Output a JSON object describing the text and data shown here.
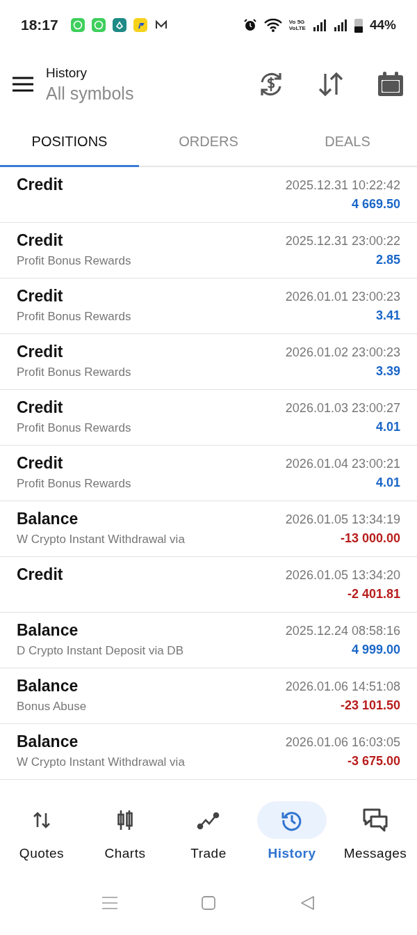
{
  "status_bar": {
    "time": "18:17",
    "network_top": "Vo 5G",
    "network_bottom": "VoLTE",
    "battery": "44%"
  },
  "header": {
    "title": "History",
    "subtitle": "All symbols"
  },
  "tabs": [
    {
      "label": "POSITIONS",
      "selected": true
    },
    {
      "label": "ORDERS",
      "selected": false
    },
    {
      "label": "DEALS",
      "selected": false
    }
  ],
  "rows": [
    {
      "type": "Credit",
      "time": "2025.12.31 10:22:42",
      "amount": "4 669.50",
      "kind": "positive"
    },
    {
      "type": "Credit",
      "comment": "Profit Bonus Rewards",
      "time": "2025.12.31 23:00:22",
      "amount": "2.85",
      "kind": "positive"
    },
    {
      "type": "Credit",
      "comment": "Profit Bonus Rewards",
      "time": "2026.01.01 23:00:23",
      "amount": "3.41",
      "kind": "positive"
    },
    {
      "type": "Credit",
      "comment": "Profit Bonus Rewards",
      "time": "2026.01.02 23:00:23",
      "amount": "3.39",
      "kind": "positive"
    },
    {
      "type": "Credit",
      "comment": "Profit Bonus Rewards",
      "time": "2026.01.03 23:00:27",
      "amount": "4.01",
      "kind": "positive"
    },
    {
      "type": "Credit",
      "comment": "Profit Bonus Rewards",
      "time": "2026.01.04 23:00:21",
      "amount": "4.01",
      "kind": "positive"
    },
    {
      "type": "Balance",
      "comment": "W Crypto Instant Withdrawal via",
      "time": "2026.01.05 13:34:19",
      "amount": "-13 000.00",
      "kind": "negative"
    },
    {
      "type": "Credit",
      "time": "2026.01.05 13:34:20",
      "amount": "-2 401.81",
      "kind": "negative"
    },
    {
      "type": "Balance",
      "comment": "D Crypto Instant Deposit via DB",
      "time": "2025.12.24 08:58:16",
      "amount": "4 999.00",
      "kind": "positive"
    },
    {
      "type": "Balance",
      "comment": "Bonus Abuse",
      "time": "2026.01.06 14:51:08",
      "amount": "-23 101.50",
      "kind": "negative"
    },
    {
      "type": "Balance",
      "comment": "W Crypto Instant Withdrawal via",
      "time": "2026.01.06 16:03:05",
      "amount": "-3 675.00",
      "kind": "negative"
    }
  ],
  "bottom_nav": [
    {
      "label": "Quotes",
      "kind": "quotes",
      "selected": false
    },
    {
      "label": "Charts",
      "kind": "charts",
      "selected": false
    },
    {
      "label": "Trade",
      "kind": "trade",
      "selected": false
    },
    {
      "label": "History",
      "kind": "history",
      "selected": true
    },
    {
      "label": "Messages",
      "kind": "messages",
      "selected": false
    }
  ]
}
